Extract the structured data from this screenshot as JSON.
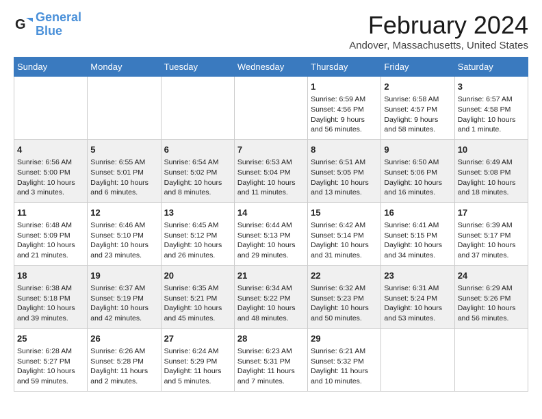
{
  "logo": {
    "line1": "General",
    "line2": "Blue"
  },
  "title": "February 2024",
  "subtitle": "Andover, Massachusetts, United States",
  "headers": [
    "Sunday",
    "Monday",
    "Tuesday",
    "Wednesday",
    "Thursday",
    "Friday",
    "Saturday"
  ],
  "weeks": [
    [
      {
        "day": "",
        "info": ""
      },
      {
        "day": "",
        "info": ""
      },
      {
        "day": "",
        "info": ""
      },
      {
        "day": "",
        "info": ""
      },
      {
        "day": "1",
        "info": "Sunrise: 6:59 AM\nSunset: 4:56 PM\nDaylight: 9 hours\nand 56 minutes."
      },
      {
        "day": "2",
        "info": "Sunrise: 6:58 AM\nSunset: 4:57 PM\nDaylight: 9 hours\nand 58 minutes."
      },
      {
        "day": "3",
        "info": "Sunrise: 6:57 AM\nSunset: 4:58 PM\nDaylight: 10 hours\nand 1 minute."
      }
    ],
    [
      {
        "day": "4",
        "info": "Sunrise: 6:56 AM\nSunset: 5:00 PM\nDaylight: 10 hours\nand 3 minutes."
      },
      {
        "day": "5",
        "info": "Sunrise: 6:55 AM\nSunset: 5:01 PM\nDaylight: 10 hours\nand 6 minutes."
      },
      {
        "day": "6",
        "info": "Sunrise: 6:54 AM\nSunset: 5:02 PM\nDaylight: 10 hours\nand 8 minutes."
      },
      {
        "day": "7",
        "info": "Sunrise: 6:53 AM\nSunset: 5:04 PM\nDaylight: 10 hours\nand 11 minutes."
      },
      {
        "day": "8",
        "info": "Sunrise: 6:51 AM\nSunset: 5:05 PM\nDaylight: 10 hours\nand 13 minutes."
      },
      {
        "day": "9",
        "info": "Sunrise: 6:50 AM\nSunset: 5:06 PM\nDaylight: 10 hours\nand 16 minutes."
      },
      {
        "day": "10",
        "info": "Sunrise: 6:49 AM\nSunset: 5:08 PM\nDaylight: 10 hours\nand 18 minutes."
      }
    ],
    [
      {
        "day": "11",
        "info": "Sunrise: 6:48 AM\nSunset: 5:09 PM\nDaylight: 10 hours\nand 21 minutes."
      },
      {
        "day": "12",
        "info": "Sunrise: 6:46 AM\nSunset: 5:10 PM\nDaylight: 10 hours\nand 23 minutes."
      },
      {
        "day": "13",
        "info": "Sunrise: 6:45 AM\nSunset: 5:12 PM\nDaylight: 10 hours\nand 26 minutes."
      },
      {
        "day": "14",
        "info": "Sunrise: 6:44 AM\nSunset: 5:13 PM\nDaylight: 10 hours\nand 29 minutes."
      },
      {
        "day": "15",
        "info": "Sunrise: 6:42 AM\nSunset: 5:14 PM\nDaylight: 10 hours\nand 31 minutes."
      },
      {
        "day": "16",
        "info": "Sunrise: 6:41 AM\nSunset: 5:15 PM\nDaylight: 10 hours\nand 34 minutes."
      },
      {
        "day": "17",
        "info": "Sunrise: 6:39 AM\nSunset: 5:17 PM\nDaylight: 10 hours\nand 37 minutes."
      }
    ],
    [
      {
        "day": "18",
        "info": "Sunrise: 6:38 AM\nSunset: 5:18 PM\nDaylight: 10 hours\nand 39 minutes."
      },
      {
        "day": "19",
        "info": "Sunrise: 6:37 AM\nSunset: 5:19 PM\nDaylight: 10 hours\nand 42 minutes."
      },
      {
        "day": "20",
        "info": "Sunrise: 6:35 AM\nSunset: 5:21 PM\nDaylight: 10 hours\nand 45 minutes."
      },
      {
        "day": "21",
        "info": "Sunrise: 6:34 AM\nSunset: 5:22 PM\nDaylight: 10 hours\nand 48 minutes."
      },
      {
        "day": "22",
        "info": "Sunrise: 6:32 AM\nSunset: 5:23 PM\nDaylight: 10 hours\nand 50 minutes."
      },
      {
        "day": "23",
        "info": "Sunrise: 6:31 AM\nSunset: 5:24 PM\nDaylight: 10 hours\nand 53 minutes."
      },
      {
        "day": "24",
        "info": "Sunrise: 6:29 AM\nSunset: 5:26 PM\nDaylight: 10 hours\nand 56 minutes."
      }
    ],
    [
      {
        "day": "25",
        "info": "Sunrise: 6:28 AM\nSunset: 5:27 PM\nDaylight: 10 hours\nand 59 minutes."
      },
      {
        "day": "26",
        "info": "Sunrise: 6:26 AM\nSunset: 5:28 PM\nDaylight: 11 hours\nand 2 minutes."
      },
      {
        "day": "27",
        "info": "Sunrise: 6:24 AM\nSunset: 5:29 PM\nDaylight: 11 hours\nand 5 minutes."
      },
      {
        "day": "28",
        "info": "Sunrise: 6:23 AM\nSunset: 5:31 PM\nDaylight: 11 hours\nand 7 minutes."
      },
      {
        "day": "29",
        "info": "Sunrise: 6:21 AM\nSunset: 5:32 PM\nDaylight: 11 hours\nand 10 minutes."
      },
      {
        "day": "",
        "info": ""
      },
      {
        "day": "",
        "info": ""
      }
    ]
  ]
}
